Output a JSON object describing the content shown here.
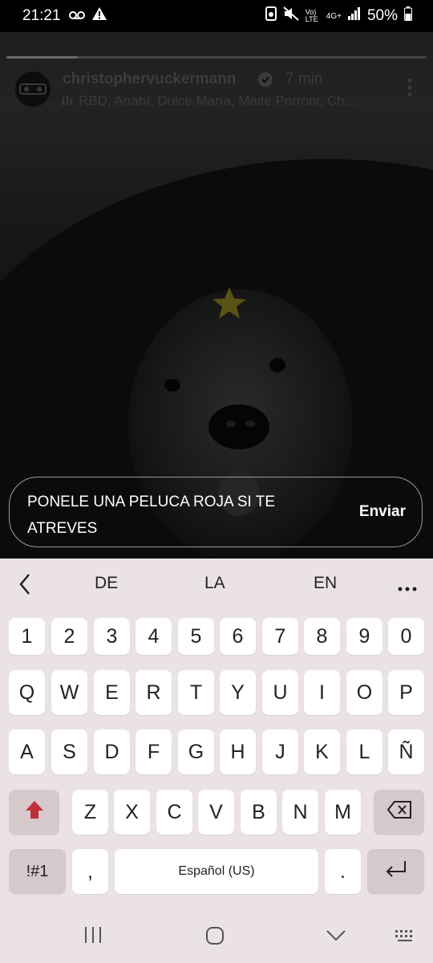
{
  "status_bar": {
    "time": "21:21",
    "battery_percent": "50%",
    "network": "4G+",
    "volte": "Vo) LTE"
  },
  "story": {
    "username": "christophervuckermann",
    "time_ago": "7 min",
    "music_label": "RBD, Anahí, Dulce María, Maite Perroni, Ch...",
    "progress": 0.17
  },
  "reply": {
    "text": "PONELE UNA PELUCA ROJA SI TE ATREVES",
    "send_label": "Enviar"
  },
  "keyboard": {
    "suggestions": [
      "DE",
      "LA",
      "EN"
    ],
    "row_numbers": [
      "1",
      "2",
      "3",
      "4",
      "5",
      "6",
      "7",
      "8",
      "9",
      "0"
    ],
    "row1": [
      "Q",
      "W",
      "E",
      "R",
      "T",
      "Y",
      "U",
      "I",
      "O",
      "P"
    ],
    "row2": [
      "A",
      "S",
      "D",
      "F",
      "G",
      "H",
      "J",
      "K",
      "L",
      "Ñ"
    ],
    "row3": [
      "Z",
      "X",
      "C",
      "V",
      "B",
      "N",
      "M"
    ],
    "symbols_label": "!#1",
    "comma_label": ",",
    "space_label": "Español (US)",
    "period_label": ".",
    "colors": {
      "shift": "#c0303a",
      "keyboard_bg": "#ebe2e4",
      "fn_key": "#d6c9cc"
    }
  },
  "icons": {
    "status": [
      "voicemail-icon",
      "warning-icon",
      "screenshot-icon",
      "mute-icon",
      "signal-icon",
      "battery-icon"
    ],
    "keyboard": [
      "back-chevron-icon",
      "more-icon",
      "shift-icon",
      "backspace-icon",
      "enter-icon"
    ],
    "nav": [
      "recents-icon",
      "home-icon",
      "back-icon",
      "keyboard-icon"
    ]
  }
}
